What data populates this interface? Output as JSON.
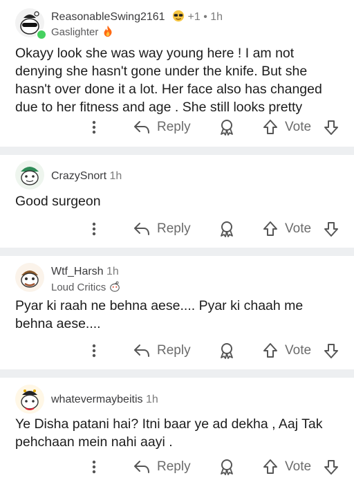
{
  "comments": [
    {
      "username": "ReasonableSwing2161",
      "award_count": "+1",
      "age": "1h",
      "flair": "Gaslighter",
      "flair_emoji": "fire-icon",
      "body": "Okayy look she was way young here ! I am not denying she hasn't gone under the knife. But she hasn't over done it a lot. Her face also has changed due to her fitness and age . She still looks pretty",
      "reply_label": "Reply",
      "vote_label": "Vote",
      "online": true
    },
    {
      "username": "CrazySnort",
      "age": "1h",
      "body": "Good surgeon",
      "reply_label": "Reply",
      "vote_label": "Vote"
    },
    {
      "username": "Wtf_Harsh",
      "age": "1h",
      "flair": "Loud Critics",
      "body": "Pyar ki raah ne behna aese.... Pyar ki chaah me behna aese....",
      "reply_label": "Reply",
      "vote_label": "Vote"
    },
    {
      "username": "whatevermaybeitis",
      "age": "1h",
      "body": "Ye Disha patani hai? Itni baar ye ad dekha , Aaj Tak pehchaan mein nahi aayi .",
      "reply_label": "Reply",
      "vote_label": "Vote"
    }
  ],
  "colors": {
    "separator": "#edeff1",
    "online": "#46d160",
    "text": "#1c1c1c",
    "muted": "#6b6b6b"
  }
}
